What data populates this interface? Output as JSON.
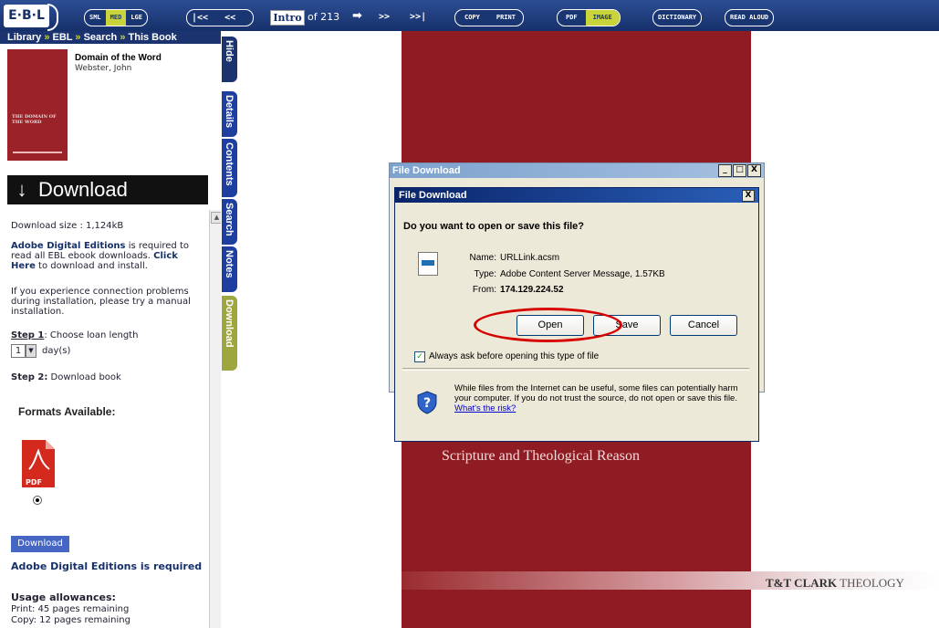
{
  "toolbar": {
    "logo": "E·B·L",
    "size_buttons": [
      "SML",
      "MED",
      "LGE"
    ],
    "first": "|<<",
    "prev": "<<",
    "page_current": "Intro",
    "page_total": "of 213",
    "go": "➡",
    "next": ">>",
    "last": ">>|",
    "copy": "COPY",
    "print": "PRINT",
    "pdf": "PDF",
    "image": "IMAGE",
    "dictionary": "DICTIONARY",
    "read_aloud": "READ ALOUD"
  },
  "breadcrumb": [
    "Library",
    "EBL",
    "Search",
    "This Book"
  ],
  "book": {
    "title": "Domain of the Word",
    "author": "Webster, John",
    "cover_text": "THE DOMAIN OF THE WORD"
  },
  "tabs": [
    "Hide",
    "Details",
    "Contents",
    "Search",
    "Notes",
    "Download"
  ],
  "download_panel": {
    "heading": "Download",
    "size": "Download size : 1,124kB",
    "ade_bold": "Adobe Digital Editions",
    "ade_rest": " is required to read all EBL ebook downloads.",
    "click_here": "Click Here",
    "click_rest": " to download and install.",
    "trouble": "If you experience connection problems during installation, please try a manual installation.",
    "step1_label": "Step 1",
    "step1_text": ": Choose loan length",
    "loan_value": "1",
    "loan_unit": "day(s)",
    "step2_label": "Step 2:",
    "step2_text": " Download book",
    "formats": "Formats Available:",
    "pdf_label": "PDF",
    "download_btn": "Download",
    "ade_required": "Adobe Digital Editions is required",
    "usage_title": "Usage allowances:",
    "usage_print": "Print: 45 pages remaining",
    "usage_copy": "Copy: 12 pages remaining"
  },
  "cover": {
    "subtitle": "Scripture and Theological Reason",
    "publisher_bold": "T&T CLARK",
    "publisher_rest": " THEOLOGY"
  },
  "outer_dialog": {
    "title": "File Download",
    "min": "_",
    "max": "□",
    "close": "X"
  },
  "dialog": {
    "title": "File Download",
    "close": "X",
    "question": "Do you want to open or save this file?",
    "name_label": "Name:",
    "name_value": "URLLink.acsm",
    "type_label": "Type:",
    "type_value": "Adobe Content Server Message, 1.57KB",
    "from_label": "From:",
    "from_value": "174.129.224.52",
    "open": "Open",
    "save": "Save",
    "cancel": "Cancel",
    "always_ask": "Always ask before opening this type of file",
    "warning": "While files from the Internet can be useful, some files can potentially harm your computer. If you do not trust the source, do not open or save this file. ",
    "risk_link": "What's the risk?"
  },
  "colors": {
    "toolbar": "#1f3a7a",
    "accent": "#c9d33a",
    "cover": "#8f1c22",
    "annotation": "#d60000"
  }
}
